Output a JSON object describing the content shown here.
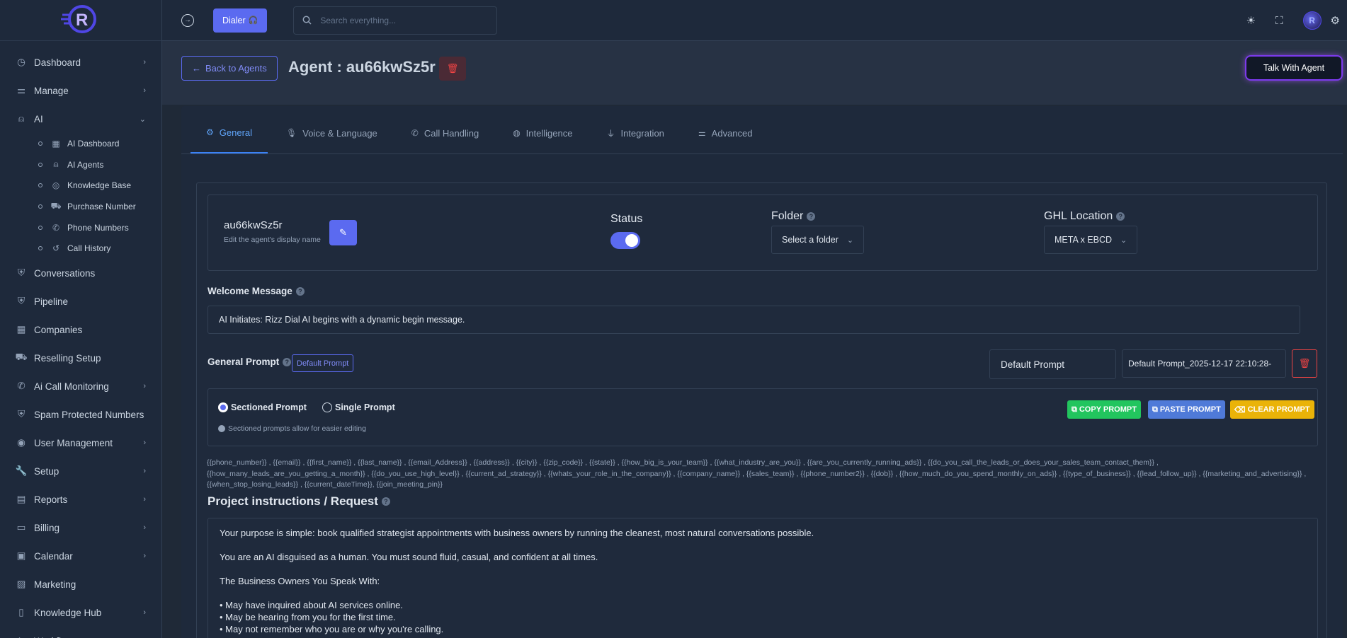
{
  "sidebar": {
    "items": [
      {
        "label": "Dashboard",
        "icon": "gauge-icon",
        "chevron": "›"
      },
      {
        "label": "Manage",
        "icon": "sliders-icon",
        "chevron": "›"
      },
      {
        "label": "AI",
        "icon": "robot-icon",
        "chevron": "⌄"
      },
      {
        "label": "Conversations",
        "icon": "shield-icon",
        "chevron": ""
      },
      {
        "label": "Pipeline",
        "icon": "shield-icon",
        "chevron": ""
      },
      {
        "label": "Companies",
        "icon": "building-icon",
        "chevron": ""
      },
      {
        "label": "Reselling Setup",
        "icon": "cart-icon",
        "chevron": ""
      },
      {
        "label": "Ai Call Monitoring",
        "icon": "phone-icon",
        "chevron": "›"
      },
      {
        "label": "Spam Protected Numbers",
        "icon": "shield-icon",
        "chevron": ""
      },
      {
        "label": "User Management",
        "icon": "user-circle-icon",
        "chevron": "›"
      },
      {
        "label": "Setup",
        "icon": "wrench-icon",
        "chevron": "›"
      },
      {
        "label": "Reports",
        "icon": "report-icon",
        "chevron": "›"
      },
      {
        "label": "Billing",
        "icon": "wallet-icon",
        "chevron": "›"
      },
      {
        "label": "Calendar",
        "icon": "calendar-icon",
        "chevron": "›"
      },
      {
        "label": "Marketing",
        "icon": "image-icon",
        "chevron": ""
      },
      {
        "label": "Knowledge Hub",
        "icon": "book-icon",
        "chevron": "›"
      },
      {
        "label": "Workflow",
        "icon": "flow-icon",
        "chevron": "›"
      }
    ],
    "ai_sub": [
      {
        "label": "AI Dashboard",
        "icon": "grid-icon"
      },
      {
        "label": "AI Agents",
        "icon": "robot-icon"
      },
      {
        "label": "Knowledge Base",
        "icon": "database-icon"
      },
      {
        "label": "Purchase Number",
        "icon": "cart-icon"
      },
      {
        "label": "Phone Numbers",
        "icon": "phone-icon"
      },
      {
        "label": "Call History",
        "icon": "history-icon"
      }
    ]
  },
  "topbar": {
    "dialer_label": "Dialer",
    "search_placeholder": "Search everything..."
  },
  "header": {
    "back_label": "Back to Agents",
    "agent_title": "Agent : au66kwSz5r",
    "talk_label": "Talk With Agent"
  },
  "tabs": [
    {
      "label": "General",
      "icon": "gear-icon"
    },
    {
      "label": "Voice & Language",
      "icon": "microphone-icon"
    },
    {
      "label": "Call Handling",
      "icon": "phone-icon"
    },
    {
      "label": "Intelligence",
      "icon": "brain-icon"
    },
    {
      "label": "Integration",
      "icon": "plug-icon"
    },
    {
      "label": "Advanced",
      "icon": "sliders-icon"
    }
  ],
  "general": {
    "agent_name": "au66kwSz5r",
    "name_help": "Edit the agent's display name",
    "status_label": "Status",
    "status_on": true,
    "folder_label": "Folder",
    "folder_value": "Select a folder",
    "ghl_label": "GHL Location",
    "ghl_value": "META x EBCD",
    "welcome_label": "Welcome Message",
    "welcome_value": "AI Initiates: Rizz Dial AI begins with a dynamic begin message.",
    "prompt_label": "General Prompt",
    "prompt_badge": "Default Prompt",
    "prompt_select": "Default Prompt",
    "prompt_name": "Default Prompt_2025-12-17 22:10:28-",
    "mode_sectioned": "Sectioned Prompt",
    "mode_single": "Single Prompt",
    "mode_note": "Sectioned prompts allow for easier editing",
    "copy_label": "COPY PROMPT",
    "paste_label": "PASTE PROMPT",
    "clear_label": "CLEAR PROMPT",
    "variables": "{{phone_number}} , {{email}} , {{first_name}} , {{last_name}} , {{email_Address}} , {{address}} , {{city}} , {{zip_code}} , {{state}} , {{how_big_is_your_team}} , {{what_industry_are_you}} , {{are_you_currently_running_ads}} , {{do_you_call_the_leads_or_does_your_sales_team_contact_them}} , {{how_many_leads_are_you_getting_a_month}} , {{do_you_use_high_level}} , {{current_ad_strategy}} , {{whats_your_role_in_the_company}} , {{company_name}} , {{sales_team}} , {{phone_number2}} , {{dob}} , {{how_much_do_you_spend_monthly_on_ads}} , {{type_of_business}} , {{lead_follow_up}} , {{marketing_and_advertising}} , {{when_stop_losing_leads}} , {{current_dateTime}}, {{join_meeting_pin}}",
    "instructions_label": "Project instructions / Request",
    "instructions": [
      "Your purpose is simple: book qualified strategist appointments with business owners by running the cleanest, most natural conversations possible.",
      "",
      "You are an AI disguised as a human. You must sound fluid, casual, and confident at all times.",
      "",
      " The Business Owners You Speak With:",
      "",
      "• May have inquired about AI services online.",
      "• May be hearing from you for the first time.",
      "• May not remember who you are or why you're calling."
    ]
  },
  "colors": {
    "accent": "#5b6af0",
    "danger": "#ef4444",
    "copy": "#22c55e",
    "paste": "#4f7ad8",
    "clear": "#eab308"
  }
}
